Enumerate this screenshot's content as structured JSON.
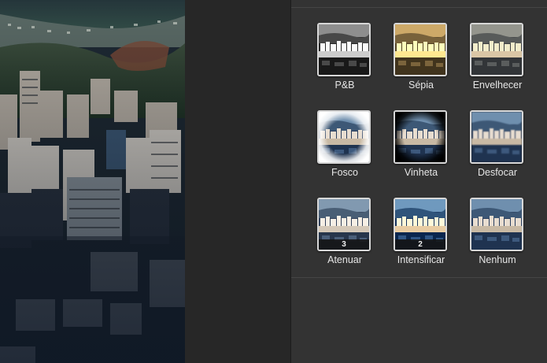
{
  "effects": [
    {
      "label": "P&B",
      "filter": "bw"
    },
    {
      "label": "Sépia",
      "filter": "sepia"
    },
    {
      "label": "Envelhecer",
      "filter": "aged"
    },
    {
      "label": "Fosco",
      "filter": "matte"
    },
    {
      "label": "Vinheta",
      "filter": "vignette"
    },
    {
      "label": "Desfocar",
      "filter": "blur"
    },
    {
      "label": "Atenuar",
      "filter": "fade",
      "count": "3"
    },
    {
      "label": "Intensificar",
      "filter": "boost",
      "count": "2"
    },
    {
      "label": "Nenhum",
      "filter": "none"
    }
  ]
}
